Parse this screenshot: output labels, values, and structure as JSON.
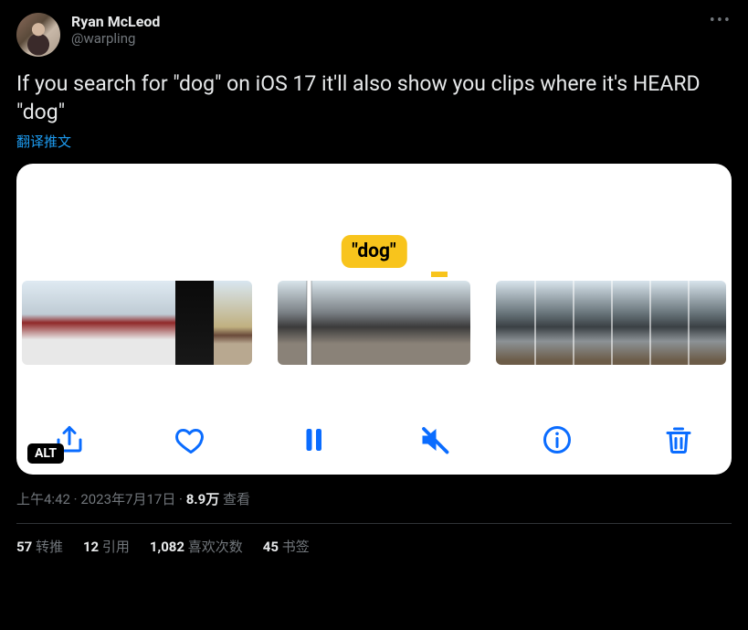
{
  "author": {
    "display_name": "Ryan McLeod",
    "handle": "@warpling"
  },
  "body": "If you search for \"dog\" on iOS 17 it'll also show you clips where it's HEARD \"dog\"",
  "translate_label": "翻译推文",
  "media": {
    "highlight_label": "\"dog\"",
    "alt_badge": "ALT"
  },
  "meta": {
    "time": "上午4:42",
    "sep": " · ",
    "date": "2023年7月17日",
    "views_count": "8.9万",
    "views_label": " 查看"
  },
  "stats": {
    "retweets_count": "57",
    "retweets_label": " 转推",
    "quotes_count": "12",
    "quotes_label": " 引用",
    "likes_count": "1,082",
    "likes_label": " 喜欢次数",
    "bookmarks_count": "45",
    "bookmarks_label": " 书签"
  }
}
